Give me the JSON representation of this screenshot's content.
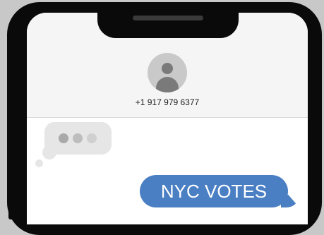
{
  "contact": {
    "phone_number": "+1 917 979 6377",
    "avatar_icon": "person-icon"
  },
  "typing_indicator": {
    "dot_colors": [
      "#a9a9a9",
      "#bdbdbd",
      "#d0d0d0"
    ]
  },
  "messages": [
    {
      "direction": "sent",
      "text": "NYC VOTES"
    }
  ],
  "colors": {
    "sent_bubble": "#4a7fc4",
    "received_bubble": "#e6e6e6",
    "frame": "#0a0a0a",
    "background": "#c8c8c8"
  }
}
